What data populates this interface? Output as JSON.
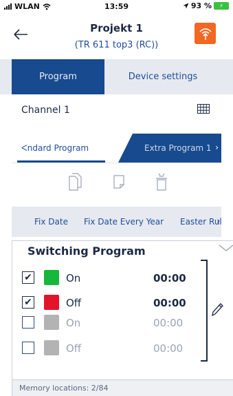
{
  "status_bar": {
    "carrier": "WLAN",
    "time": "13:59",
    "battery_percent": "93 %"
  },
  "header": {
    "title": "Projekt 1",
    "subtitle": "(TR 611 top3 (RC))",
    "back_icon": "arrow-left-icon",
    "action_icon": "bluetooth-signal-icon",
    "accent_color": "#f26722"
  },
  "main_tabs": [
    {
      "label": "Program",
      "selected": true
    },
    {
      "label": "Device settings",
      "selected": false
    }
  ],
  "channel": {
    "label": "Channel 1",
    "icon": "grid-icon"
  },
  "program_tabs": [
    {
      "label": "ᐸndard Program",
      "selected": true
    },
    {
      "label": "Extra Program 1",
      "selected": false
    }
  ],
  "tools": [
    {
      "icon": "copy-icon"
    },
    {
      "icon": "paste-icon"
    },
    {
      "icon": "delete-icon"
    }
  ],
  "filters": [
    {
      "label": "Fix Date"
    },
    {
      "label": "Fix Date Every Year"
    },
    {
      "label": "Easter Rul"
    }
  ],
  "switching_program": {
    "title": "Switching Program",
    "rows": [
      {
        "checked": true,
        "check_mark": "✔",
        "state": "On",
        "time": "00:00",
        "color": "#16b73b",
        "active": true
      },
      {
        "checked": true,
        "check_mark": "✔",
        "state": "Off",
        "time": "00:00",
        "color": "#e3132c",
        "active": true
      },
      {
        "checked": false,
        "check_mark": "",
        "state": "On",
        "time": "00:00",
        "color": "#b3b3b3",
        "active": false
      },
      {
        "checked": false,
        "check_mark": "",
        "state": "Off",
        "time": "00:00",
        "color": "#b3b3b3",
        "active": false
      }
    ],
    "edit_icon": "pencil-icon"
  },
  "footer": {
    "memory": "Memory locations: 2/84"
  },
  "colors": {
    "primary": "#174a8e",
    "accent": "#f26722",
    "on": "#16b73b",
    "off": "#e3132c"
  }
}
